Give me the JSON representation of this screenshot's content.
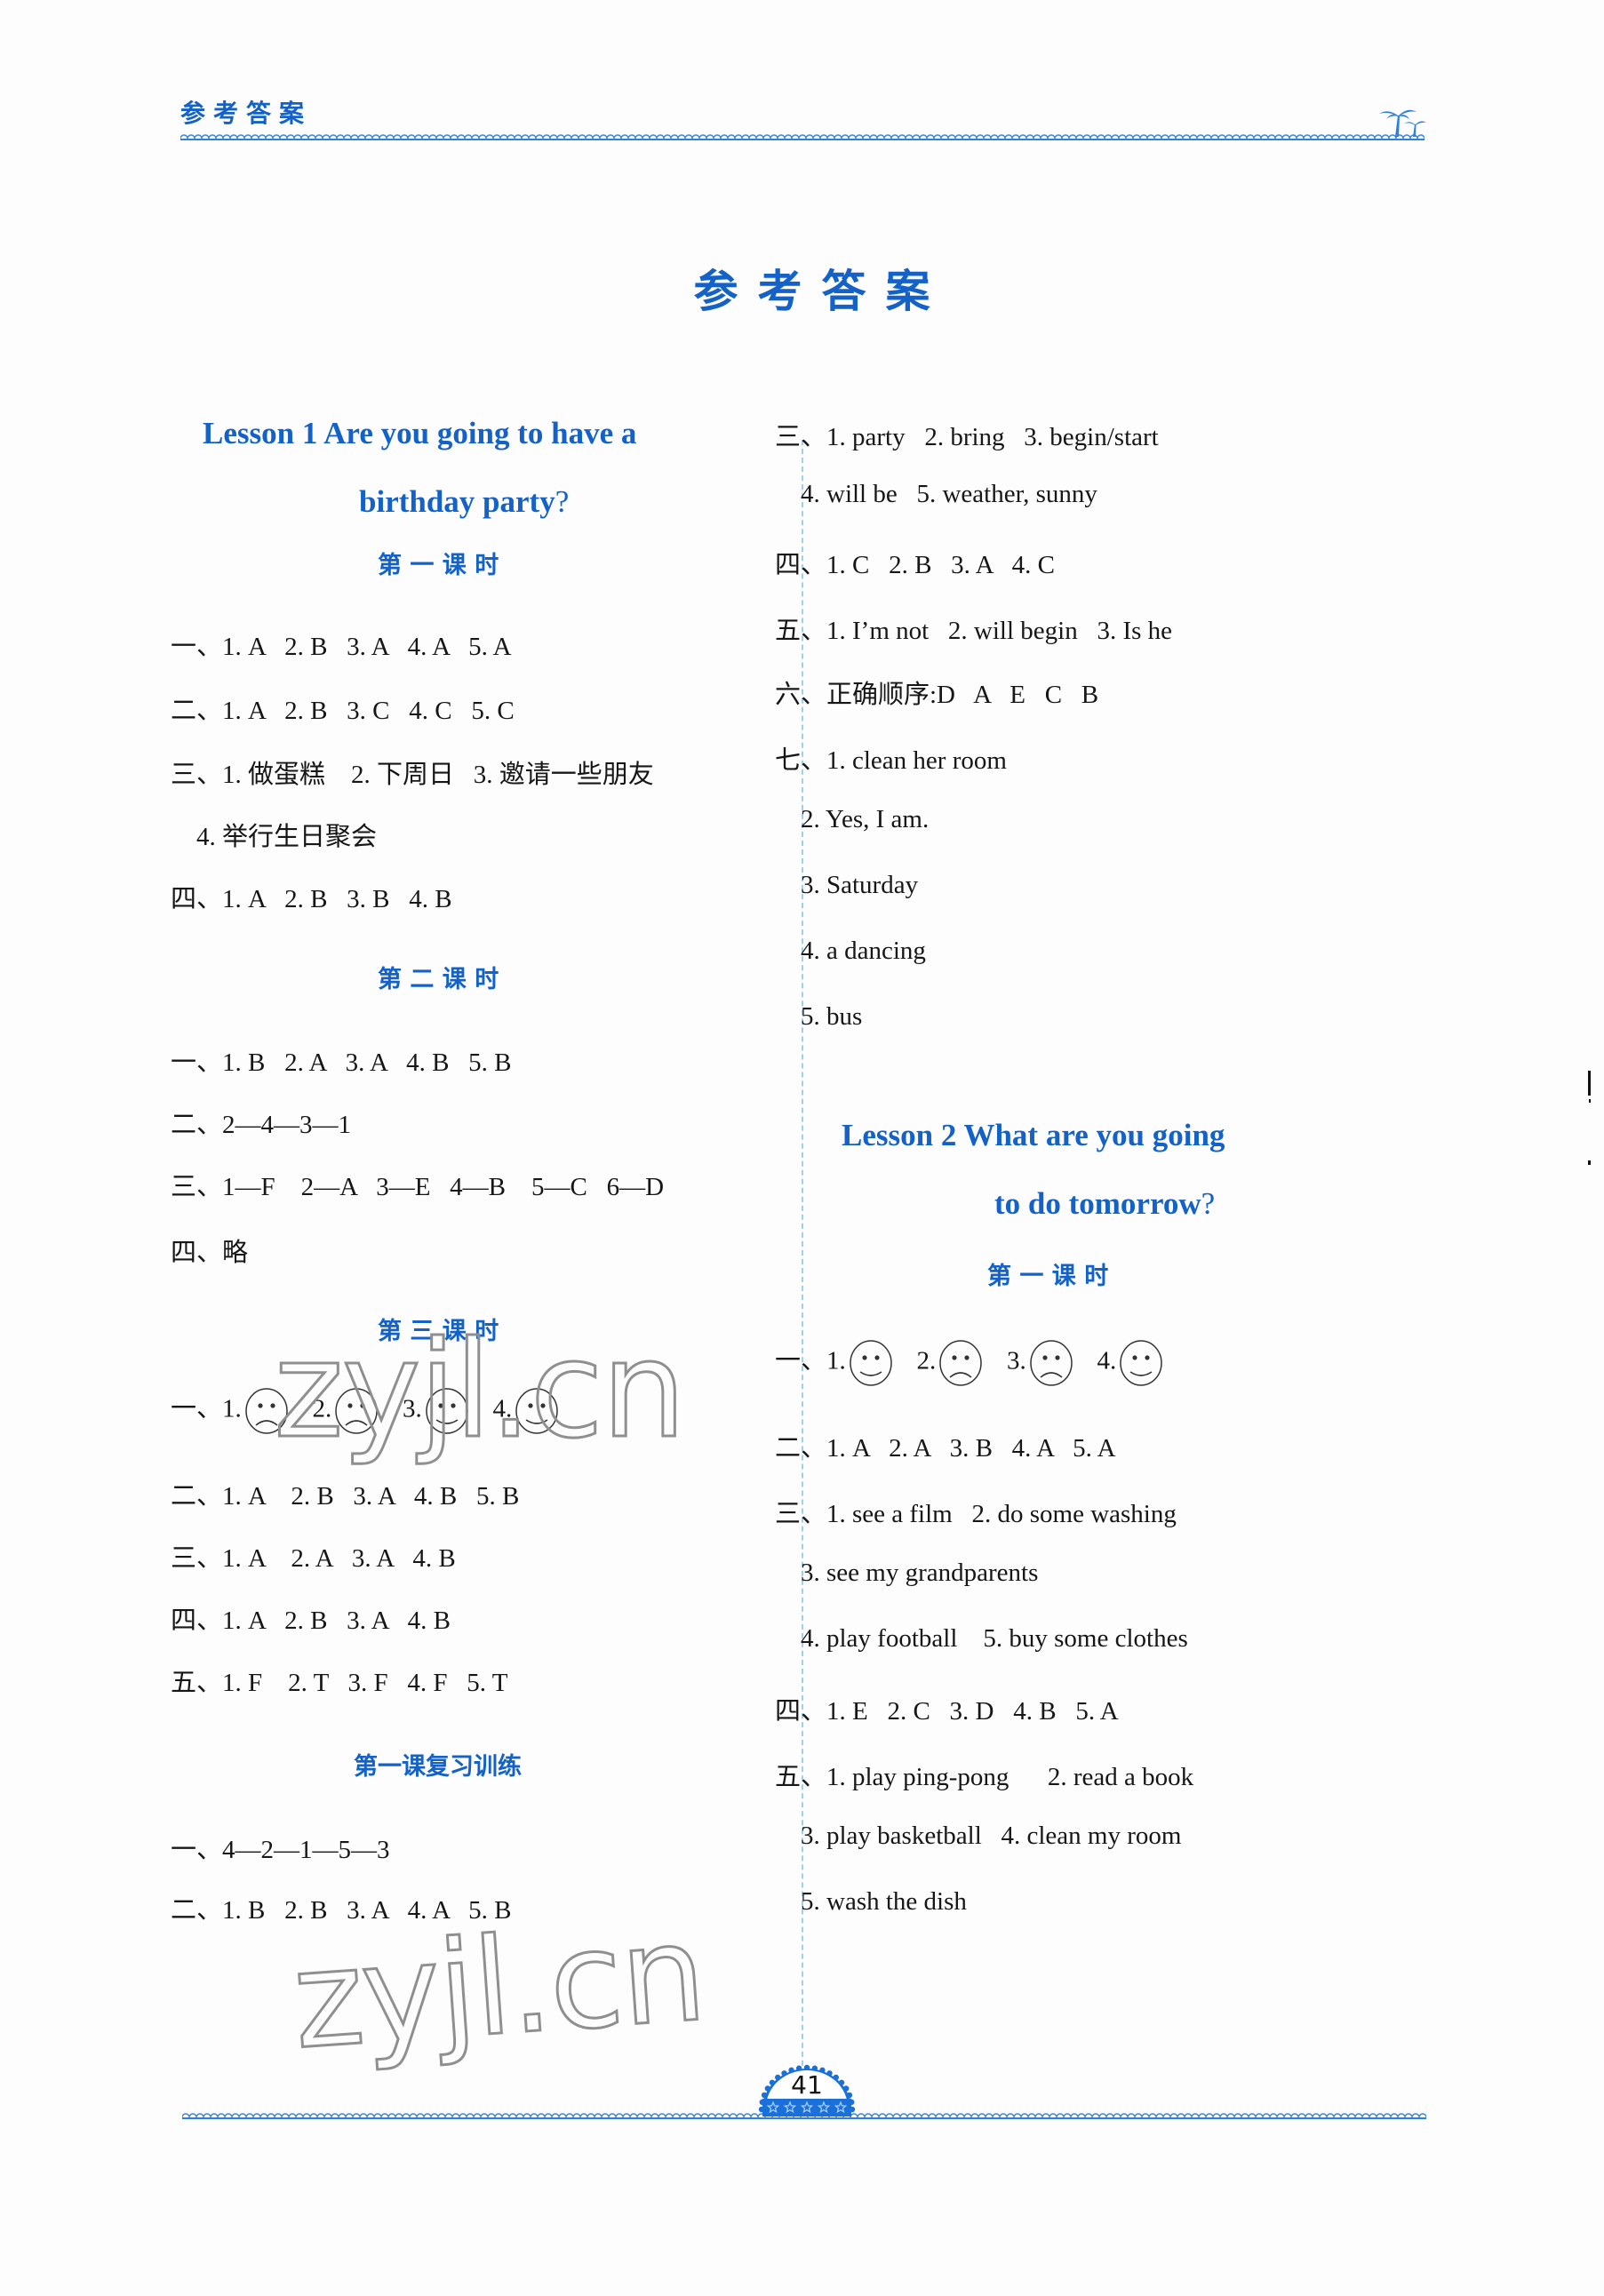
{
  "header": {
    "label": "参考答案"
  },
  "page_title": "参考答案",
  "page_number": "41",
  "watermark": "zyjl.cn",
  "colors": {
    "accent": "#1462c8",
    "divider": "#9fd0ea",
    "text": "#161616"
  },
  "left_column": {
    "lesson1": {
      "title_line1": "Lesson 1    Are you going to have a",
      "title_line2": "birthday party",
      "title_qm": "?"
    },
    "period1": {
      "heading": "第 一 课 时",
      "lines": [
        "一、1. A   2. B   3. A   4. A   5. A",
        "二、1. A   2. B   3. C   4. C   5. C",
        "三、1. 做蛋糕    2. 下周日   3. 邀请一些朋友",
        "    4. 举行生日聚会",
        "四、1. A   2. B   3. B   4. B"
      ]
    },
    "period2": {
      "heading": "第 二 课 时",
      "lines": [
        "一、1. B   2. A   3. A   4. B   5. B",
        "二、2—4—3—1",
        "三、1—F    2—A   3—E   4—B    5—C   6—D",
        "四、略"
      ]
    },
    "period3": {
      "heading": "第 三 课 时",
      "faces_prefix": "一、",
      "faces": [
        {
          "num": "1.",
          "type": "sad"
        },
        {
          "num": "2.",
          "type": "sad"
        },
        {
          "num": "3.",
          "type": "happy"
        },
        {
          "num": "4.",
          "type": "happy"
        }
      ],
      "lines": [
        "二、1. A    2. B   3. A   4. B   5. B",
        "三、1. A    2. A   3. A   4. B",
        "四、1. A   2. B   3. A   4. B",
        "五、1. F    2. T   3. F   4. F   5. T"
      ]
    },
    "review1": {
      "heading": "第一课复习训练",
      "lines": [
        "一、4—2—1—5—3",
        "二、1. B   2. B   3. A   4. A   5. B"
      ]
    }
  },
  "right_column": {
    "continued_lines": [
      "三、1. party   2. bring   3. begin/start",
      "    4. will be   5. weather, sunny",
      "四、1. C   2. B   3. A   4. C",
      "五、1. I’m not   2. will begin   3. Is he",
      "六、正确顺序:D   A   E   C   B",
      "七、1. clean her room",
      "    2. Yes, I am.",
      "    3. Saturday",
      "    4. a dancing",
      "    5. bus"
    ],
    "lesson2": {
      "title_line1": "Lesson 2    What are you going",
      "title_line2": "to do tomorrow",
      "title_qm": "?"
    },
    "period1": {
      "heading": "第 一 课 时",
      "faces_prefix": "一、",
      "faces": [
        {
          "num": "1.",
          "type": "happy"
        },
        {
          "num": "2.",
          "type": "sad"
        },
        {
          "num": "3.",
          "type": "sad"
        },
        {
          "num": "4.",
          "type": "happy"
        }
      ],
      "lines": [
        "二、1. A   2. A   3. B   4. A   5. A",
        "三、1. see a film   2. do some washing",
        "    3. see my grandparents",
        "    4. play football    5. buy some clothes",
        "四、1. E   2. C   3. D   4. B   5. A",
        "五、1. play ping-pong      2. read a book",
        "    3. play basketball   4. clean my room",
        "    5. wash the dish"
      ]
    }
  }
}
